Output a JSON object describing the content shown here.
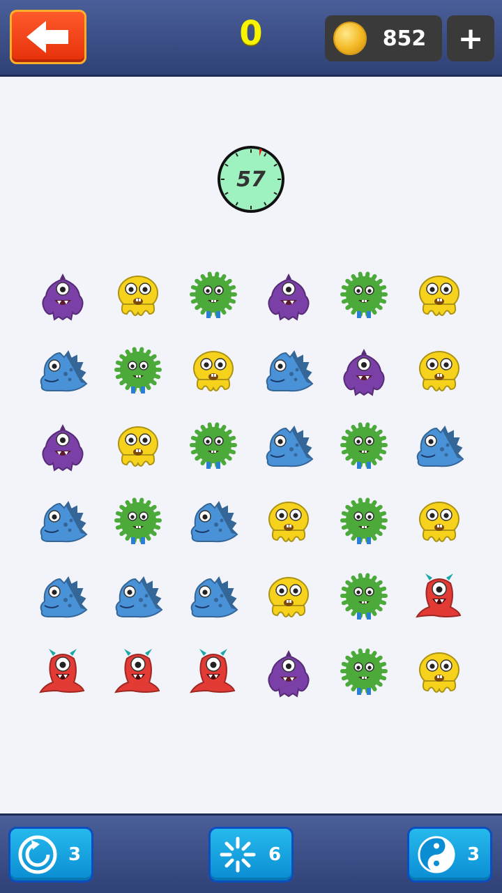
{
  "header": {
    "back_icon": "arrow-left-icon",
    "score": "0",
    "coins": "852",
    "coin_icon": "gold-coin-icon",
    "add_label": "+"
  },
  "timer": {
    "seconds": "57",
    "icon": "stopwatch-icon"
  },
  "board": {
    "rows": [
      [
        "purple",
        "yellow",
        "green",
        "purple",
        "green",
        "yellow"
      ],
      [
        "blue",
        "green",
        "yellow",
        "blue",
        "purple",
        "yellow"
      ],
      [
        "purple",
        "yellow",
        "green",
        "blue",
        "green",
        "blue"
      ],
      [
        "blue",
        "green",
        "blue",
        "yellow",
        "green",
        "yellow"
      ],
      [
        "blue",
        "blue",
        "blue",
        "yellow",
        "green",
        "red"
      ],
      [
        "red",
        "red",
        "red",
        "purple",
        "green",
        "yellow"
      ]
    ],
    "colors": {
      "purple": "#7b3fa8",
      "yellow": "#f6d21c",
      "green": "#4caa3a",
      "blue": "#4a92d8",
      "red": "#e23a34"
    }
  },
  "powerups": [
    {
      "name": "shuffle",
      "icon": "refresh-icon",
      "count": "3"
    },
    {
      "name": "hint",
      "icon": "sparkle-icon",
      "count": "6"
    },
    {
      "name": "swap",
      "icon": "yin-yang-icon",
      "count": "3"
    }
  ]
}
